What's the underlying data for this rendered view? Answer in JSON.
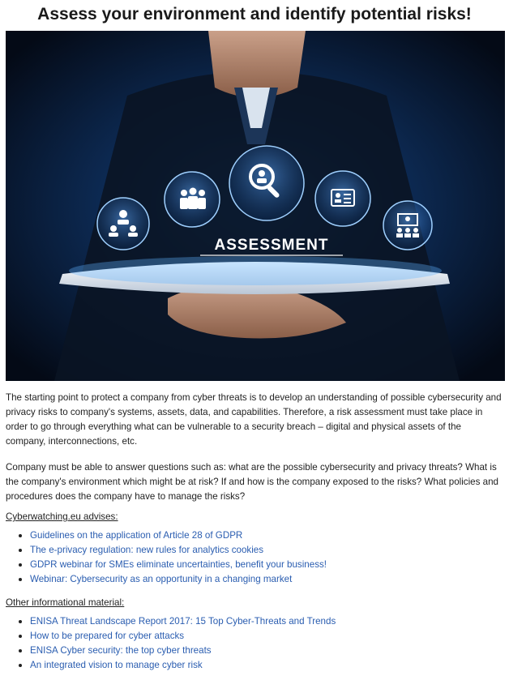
{
  "title": "Assess your environment and identify potential risks!",
  "hero": {
    "label": "ASSESSMENT"
  },
  "paragraphs": [
    "The starting point to protect a company from cyber threats is to develop an understanding of possible cybersecurity and privacy risks to company's systems, assets, data, and capabilities. Therefore, a risk assessment must take place in order to go through everything what can be vulnerable to a security breach – digital and physical assets of the company, interconnections, etc.",
    "Company must be able to answer questions such as: what are the possible cybersecurity and privacy threats? What is the company's environment which might be at risk? If and how is the company exposed to the risks? What policies and procedures does the company have to manage the risks?"
  ],
  "advises": {
    "label": "Cyberwatching.eu advises:",
    "items": [
      "Guidelines on the application of Article 28 of GDPR",
      "The e-privacy regulation: new rules for analytics cookies",
      "GDPR webinar for SMEs eliminate uncertainties, benefit your business!",
      "Webinar: Cybersecurity as an opportunity in a changing market"
    ]
  },
  "other": {
    "label": "Other informational material:",
    "items": [
      "ENISA Threat Landscape Report 2017: 15 Top Cyber-Threats and Trends",
      "How to be prepared for cyber attacks",
      "ENISA Cyber security: the top cyber threats",
      "An integrated vision to manage cyber risk"
    ]
  },
  "colors": {
    "link": "#2a5db0",
    "text": "#222222",
    "hero_bg": "#06101f"
  }
}
